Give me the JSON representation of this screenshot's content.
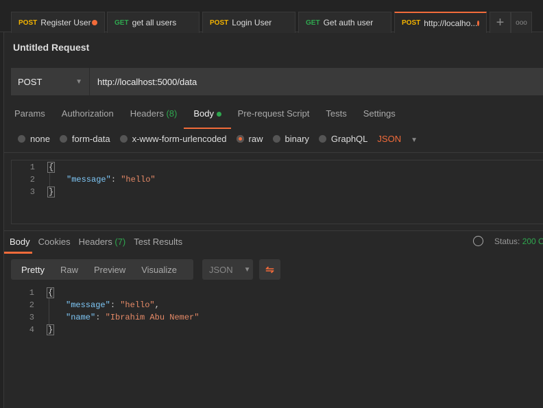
{
  "tabs": [
    {
      "method": "POST",
      "label": "Register User",
      "unsaved": true
    },
    {
      "method": "GET",
      "label": "get all users",
      "unsaved": false
    },
    {
      "method": "POST",
      "label": "Login User",
      "unsaved": false
    },
    {
      "method": "GET",
      "label": "Get auth user",
      "unsaved": false
    },
    {
      "method": "POST",
      "label": "http://localho...",
      "unsaved": true,
      "active": true
    }
  ],
  "request": {
    "title": "Untitled Request",
    "method": "POST",
    "url": "http://localhost:5000/data",
    "tabs": [
      "Params",
      "Authorization",
      "Headers",
      "Body",
      "Pre-request Script",
      "Tests",
      "Settings"
    ],
    "headers_count": "(8)",
    "active_tab": "Body",
    "body_types": [
      "none",
      "form-data",
      "x-www-form-urlencoded",
      "raw",
      "binary",
      "GraphQL"
    ],
    "selected_body_type": "raw",
    "raw_format": "JSON",
    "body_lines": [
      "{",
      "\"message\"",
      ": ",
      "\"hello\"",
      "}"
    ]
  },
  "response": {
    "tabs": [
      "Body",
      "Cookies",
      "Headers",
      "Test Results"
    ],
    "headers_count": "(7)",
    "status_label": "Status:",
    "status_value": "200 O",
    "views": [
      "Pretty",
      "Raw",
      "Preview",
      "Visualize"
    ],
    "format": "JSON",
    "lines": {
      "open": "{",
      "k1": "\"message\"",
      "v1": "\"hello\"",
      "k2": "\"name\"",
      "v2": "\"Ibrahim Abu Nemer\"",
      "close": "}"
    }
  },
  "colors": {
    "accent": "#f26b3a",
    "post": "#f4b400",
    "get": "#2fa84f",
    "key": "#7fc8f8",
    "string": "#e68a67"
  }
}
